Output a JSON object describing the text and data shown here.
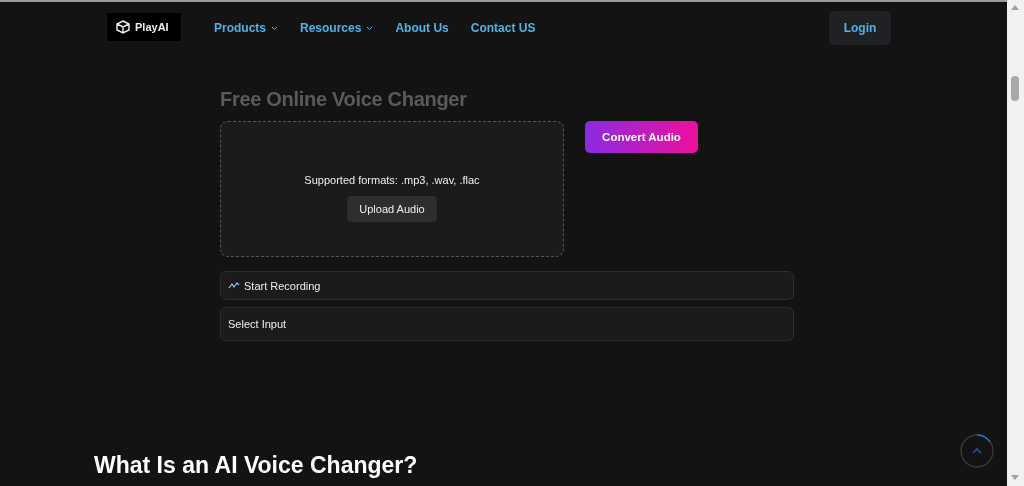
{
  "header": {
    "logo": "PlayAI",
    "nav": [
      {
        "label": "Products",
        "dropdown": true
      },
      {
        "label": "Resources",
        "dropdown": true
      },
      {
        "label": "About Us",
        "dropdown": false
      },
      {
        "label": "Contact US",
        "dropdown": false
      }
    ],
    "login": "Login"
  },
  "tool": {
    "title": "Free Online Voice Changer",
    "formats": "Supported formats: .mp3, .wav, .flac",
    "upload": "Upload Audio",
    "convert": "Convert Audio",
    "record": "Start Recording",
    "select": "Select Input"
  },
  "section_title": "What Is an AI Voice Changer?"
}
